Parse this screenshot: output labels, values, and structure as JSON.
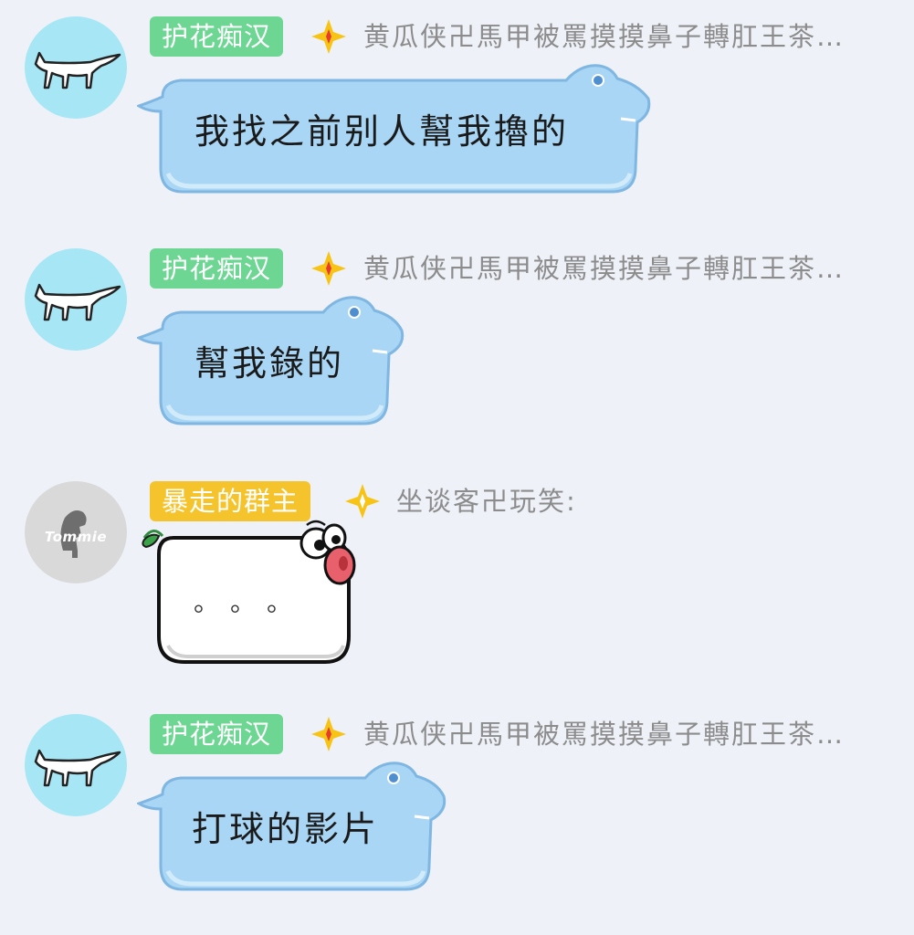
{
  "messages": [
    {
      "sender_badge": "护花痴汉",
      "sender_name": "黄瓜侠卍馬甲被罵摸摸鼻子轉肛王茶…",
      "text": "我找之前别人幫我擼的"
    },
    {
      "sender_badge": "护花痴汉",
      "sender_name": "黄瓜侠卍馬甲被罵摸摸鼻子轉肛王茶…",
      "text": "幫我錄的"
    },
    {
      "sender_badge": "暴走的群主",
      "sender_name": "坐谈客卍玩笑:",
      "avatar_label": "Tommie",
      "text": "。。。"
    },
    {
      "sender_badge": "护花痴汉",
      "sender_name": "黄瓜侠卍馬甲被罵摸摸鼻子轉肛王茶…",
      "text": "打球的影片"
    }
  ],
  "colors": {
    "background": "#eef2f8",
    "badge_green": "#6dd693",
    "badge_gold": "#f5c32c",
    "bubble_blue": "#a9d6f5",
    "avatar_fox": "#a6e6f5"
  },
  "icons": [
    "fox-avatar-icon",
    "sparkle-star-icon",
    "tommie-avatar-icon",
    "bird-bubble-icon"
  ]
}
